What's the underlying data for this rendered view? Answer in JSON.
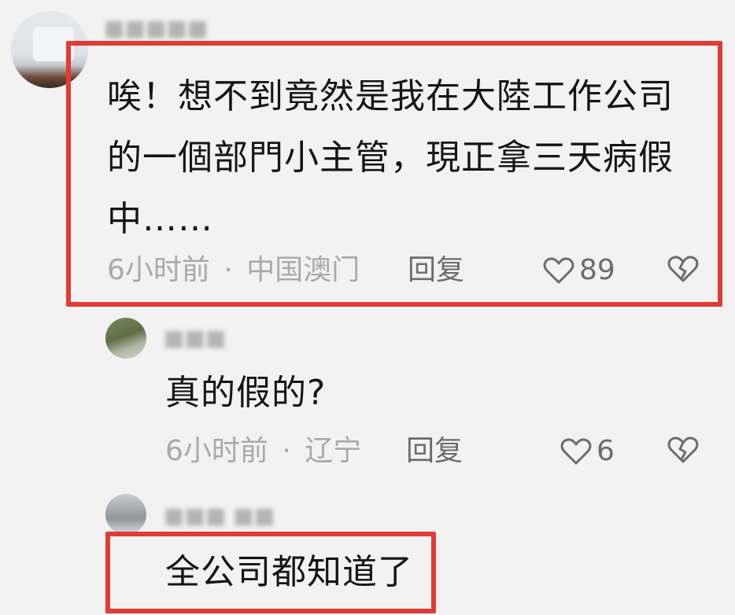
{
  "comments": [
    {
      "username": "■■■■■",
      "text": "唉！想不到竟然是我在大陸工作公司的一個部門小主管，現正拿三天病假中……",
      "time": "6小时前",
      "location": "中国澳门",
      "meta_separator": "·",
      "reply_label": "回复",
      "likes": "89"
    },
    {
      "username": "■■■",
      "text": "真的假的?",
      "time": "6小时前",
      "location": "辽宁",
      "meta_separator": "·",
      "reply_label": "回复",
      "likes": "6"
    },
    {
      "username": "■■■ ■■",
      "text": "全公司都知道了"
    }
  ],
  "colors": {
    "highlight": "#e23b33",
    "meta": "#a9a9a9",
    "action": "#6c6c6c"
  },
  "icons": [
    "heart-outline-icon",
    "broken-heart-icon"
  ]
}
